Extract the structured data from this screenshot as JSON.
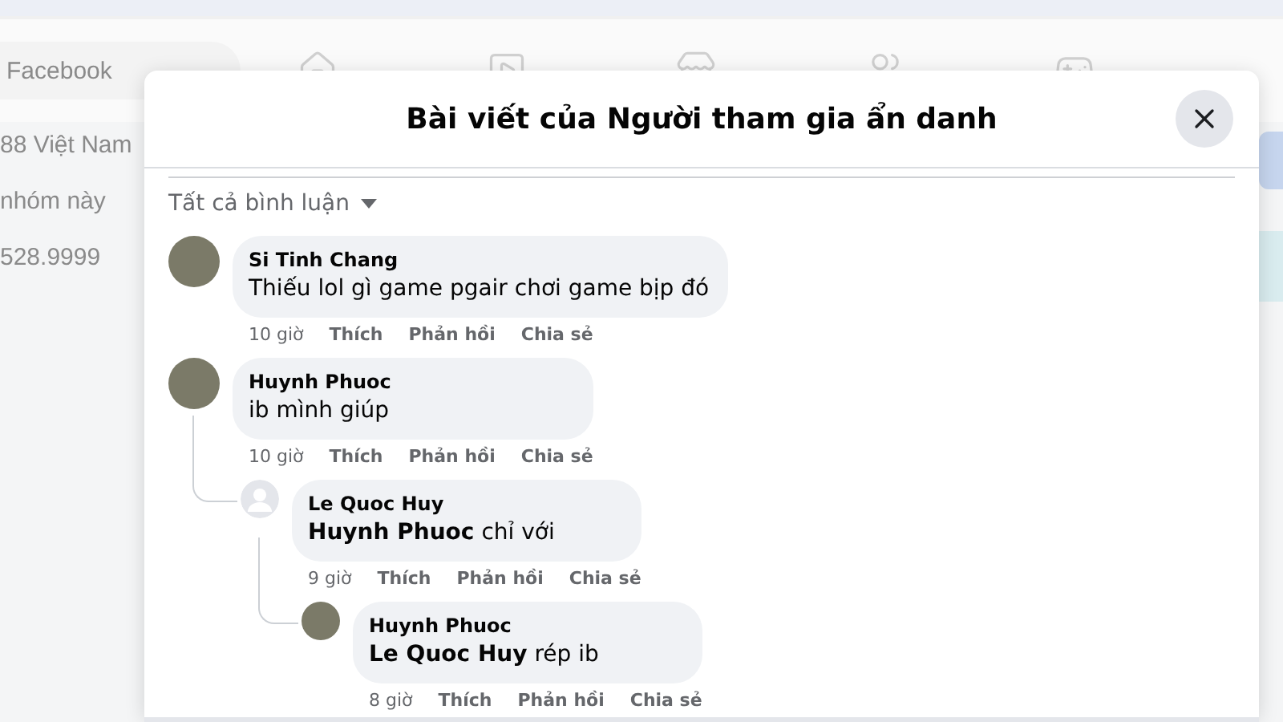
{
  "background": {
    "search": {
      "placeholder": "Facebook"
    },
    "sidebar": [
      "88 Việt Nam",
      "nhóm này",
      "528.9999"
    ]
  },
  "dialog": {
    "title": "Bài viết của Người tham gia ẩn danh",
    "filter": "Tất cả bình luận",
    "comments": [
      {
        "author": "Si Tinh Chang",
        "avatar": {
          "kind": "photo"
        },
        "text": "Thiếu lol gì game pgair chơi game bịp đó",
        "time": "10 giờ",
        "actions": [
          "Thích",
          "Phản hồi",
          "Chia sẻ"
        ]
      },
      {
        "author": "Huynh Phuoc",
        "avatar": {
          "kind": "photo"
        },
        "text": "ib mình giúp",
        "time": "10 giờ",
        "actions": [
          "Thích",
          "Phản hồi",
          "Chia sẻ"
        ],
        "children": [
          {
            "author": "Le Quoc Huy",
            "avatar": {
              "kind": "default"
            },
            "mention": "Huynh Phuoc",
            "text": "chỉ với",
            "time": "9 giờ",
            "actions": [
              "Thích",
              "Phản hồi",
              "Chia sẻ"
            ],
            "children": [
              {
                "author": "Huynh Phuoc",
                "avatar": {
                  "kind": "photo"
                },
                "mention": "Le Quoc Huy",
                "text": "rép ib",
                "time": "8 giờ",
                "actions": [
                  "Thích",
                  "Phản hồi",
                  "Chia sẻ"
                ]
              }
            ]
          }
        ]
      }
    ]
  }
}
